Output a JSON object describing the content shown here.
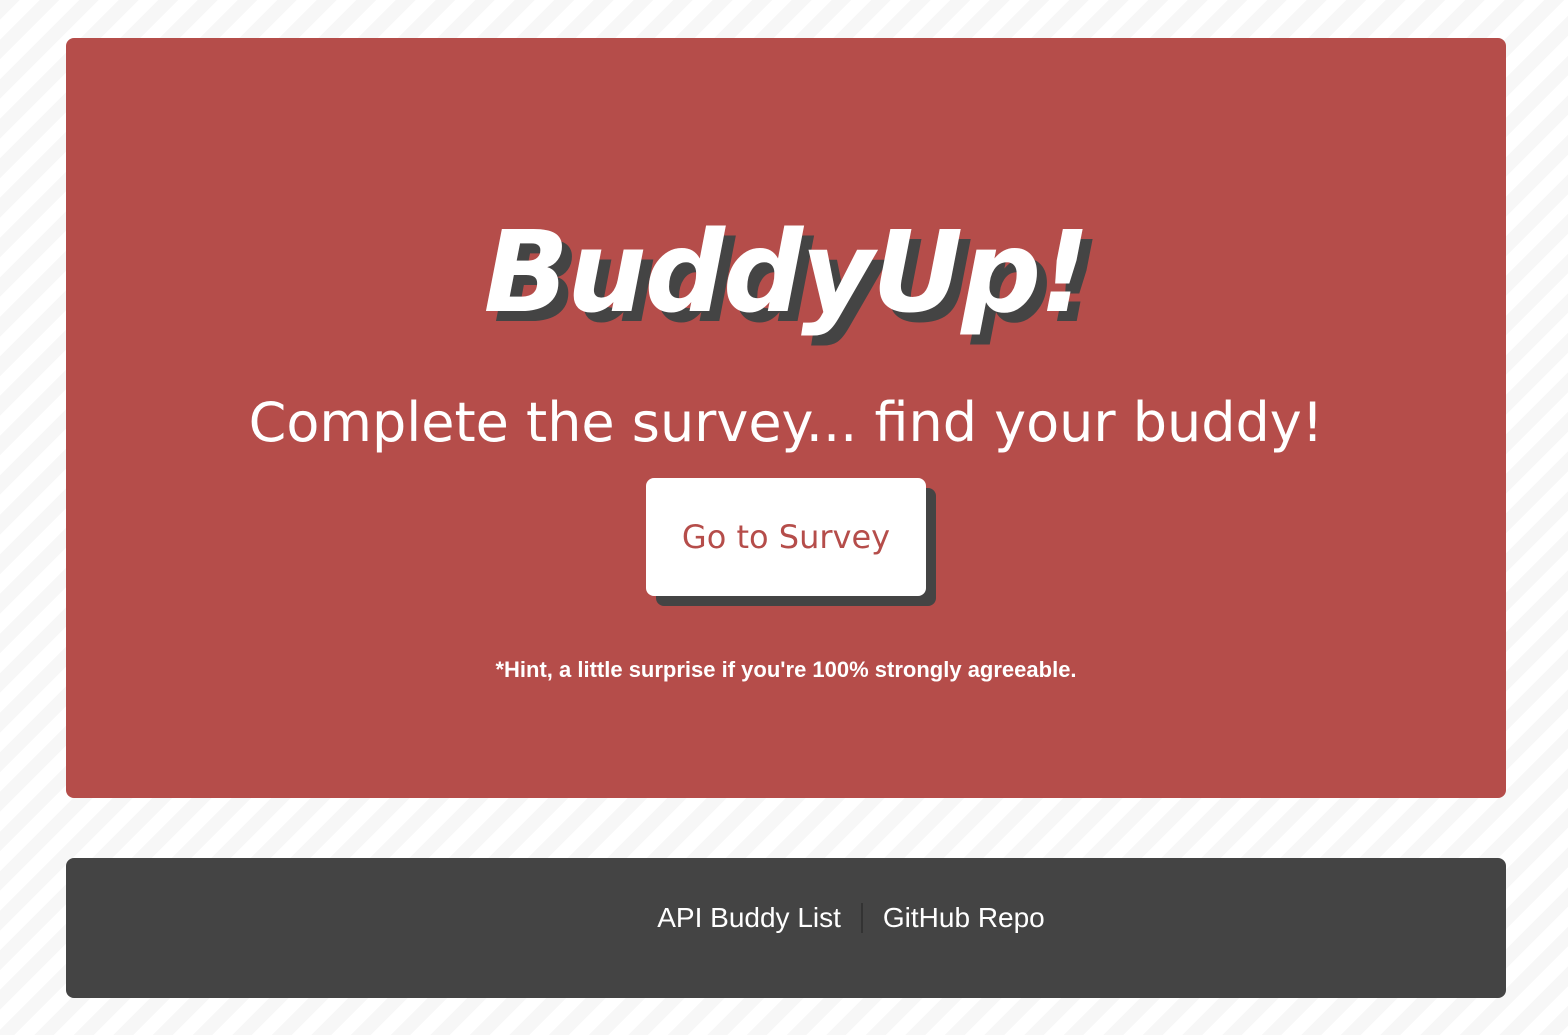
{
  "hero": {
    "title": "BuddyUp!",
    "subtitle": "Complete the survey... find your buddy!",
    "cta_label": "Go to Survey",
    "hint": "*Hint, a little surprise if you're 100% strongly agreeable."
  },
  "footer": {
    "links": [
      {
        "label": "API Buddy List"
      },
      {
        "label": "GitHub Repo"
      }
    ]
  },
  "colors": {
    "hero_background": "#b54d4a",
    "footer_background": "#444444",
    "shadow": "#444444",
    "text_light": "#ffffff",
    "page_background": "#f7f7f7"
  }
}
